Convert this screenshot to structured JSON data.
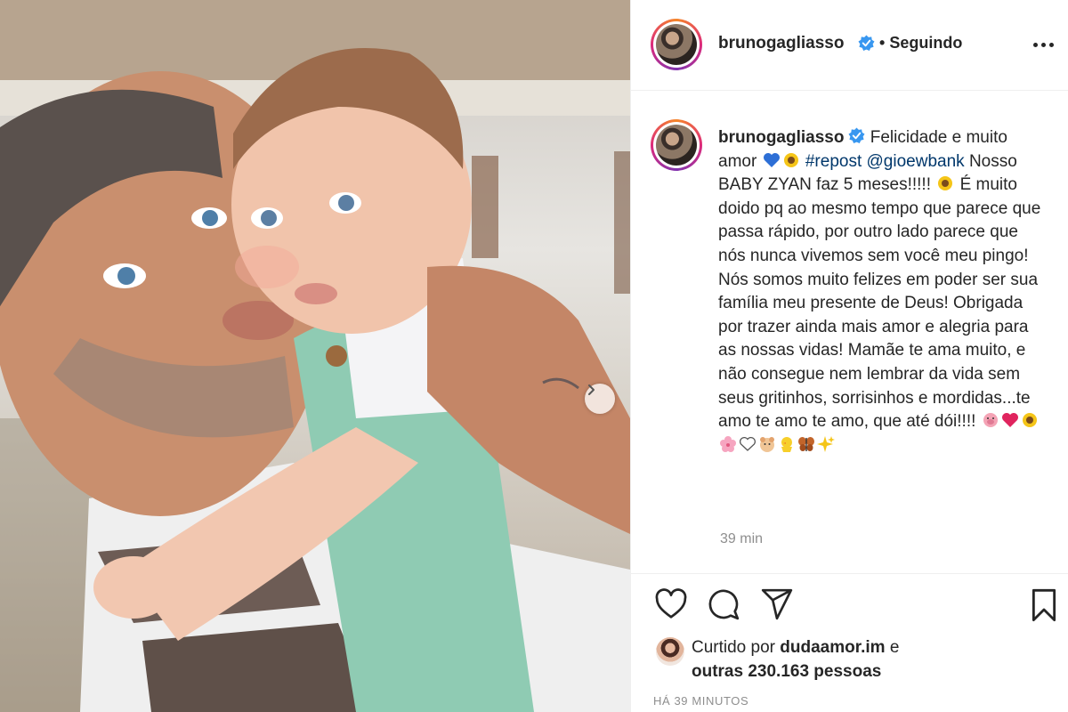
{
  "post": {
    "username": "brunogagliasso",
    "separator": "•",
    "follow_status": "Seguindo",
    "caption": {
      "part1": "Felicidade e muito amor",
      "hashtag": "#repost",
      "mention": "@gioewbank",
      "part2": "Nosso BABY ZYAN faz 5 meses!!!!!",
      "part3": "É muito doido pq ao mesmo tempo que parece que passa rápido, por outro lado parece que nós nunca vivemos sem você meu pingo! Nós somos muito felizes em poder ser sua família meu presente de Deus! Obrigada por trazer ainda mais amor e alegria para as nossas vidas! Mamãe te ama muito, e não consegue nem lembrar da vida sem seus gritinhos, sorrisinhos e mordidas...te amo te amo te amo, que até dói!!!!"
    },
    "caption_time": "39 min",
    "likes": {
      "prefix": "Curtido por",
      "liker": "dudaamor.im",
      "conjunction": "e",
      "others": "outras 230.163 pessoas"
    },
    "time_ago": "HÁ 39 MINUTOS"
  },
  "icons": {
    "verified": "verified-badge-icon",
    "more": "more-options-icon",
    "like": "heart-icon",
    "comment": "comment-icon",
    "share": "paper-plane-icon",
    "save": "bookmark-icon",
    "next": "chevron-right-icon"
  },
  "colors": {
    "text": "#262626",
    "secondary": "#8e8e8e",
    "link": "#00376b",
    "verified": "#3897f0",
    "divider": "#efefef"
  }
}
